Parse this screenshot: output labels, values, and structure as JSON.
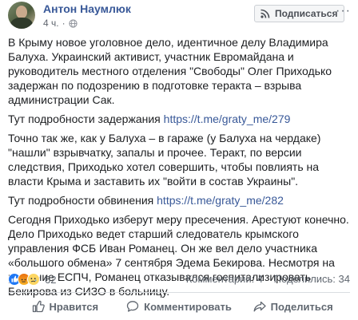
{
  "post": {
    "author": "Антон Наумлюк",
    "timestamp": "4 ч.",
    "subscribe_label": "Подписаться",
    "more_label": "···",
    "paragraphs": [
      "В Крыму новое уголовное дело, идентичное делу Владимира Балуха. Украинский активист, участник Евромайдана и руководитель местного отделения \"Свободы\" Олег Приходько задержан по подозрению в подготовке теракта – взрыва администрации Сак.",
      "Точно так же, как у Балуха – в гараже (у Балуха на чердаке) \"нашли\" взрывчатку, запалы и прочее. Теракт, по версии следствия, Приходько хотел совершить, чтобы повлиять на власти Крыма и заставить их \"войти в состав Украины\".",
      "Сегодня Приходько изберут меру пресечения. Арестуют конечно. Дело Приходько ведет старший следователь крымского управления ФСБ Иван Романец. Он же вел дело участника «большого обмена» 7 сентября Эдема Бекирова. Несмотря на решение ЕСПЧ, Романец отказывался госпитализировать Бекирова из СИЗО в больницу."
    ],
    "detention_prefix": "Тут подробности задержания",
    "detention_link": "https://t.me/graty_me/279",
    "charge_prefix": "Тут подробности обвинения",
    "charge_link": "https://t.me/graty_me/282"
  },
  "reactions": {
    "types": [
      "like",
      "angry",
      "sad"
    ],
    "count": "62",
    "comments": "Комментарии: 4",
    "shares": "Поделились: 34"
  },
  "actions": {
    "like": "Нравится",
    "comment": "Комментировать",
    "share": "Поделиться"
  },
  "colors": {
    "link": "#385898",
    "text": "#1c1e21",
    "muted": "#606770",
    "like_blue": "#2078f4"
  }
}
